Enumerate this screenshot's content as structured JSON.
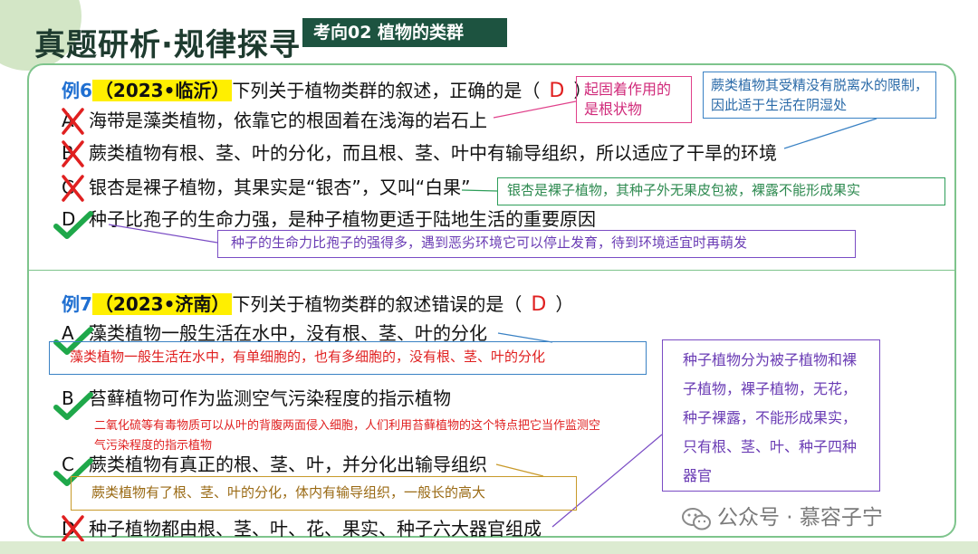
{
  "header": {
    "title": "真题研析·规律探寻",
    "topic": "考向02  植物的类群"
  },
  "q1": {
    "label": "例6",
    "source": "（2023•临沂）",
    "stem": "下列关于植物类群的叙述，正确的是（",
    "answer": "D",
    "close": "）",
    "options": [
      {
        "letter": "A",
        "text": "海带是藻类植物，依靠它的根固着在浅海的岩石上",
        "mark": "cross"
      },
      {
        "letter": "B",
        "text": "蕨类植物有根、茎、叶的分化，而且根、茎、叶中有输导组织，所以适应了干旱的环境",
        "mark": "cross"
      },
      {
        "letter": "C",
        "text": "银杏是裸子植物，其果实是“银杏”，又叫“白果”",
        "mark": "cross"
      },
      {
        "letter": "D",
        "text": "种子比孢子的生命力强，是种子植物更适于陆地生活的重要原因",
        "mark": "check"
      }
    ],
    "notes": {
      "a": "起固着作用的是根状物",
      "b": "蕨类植物其受精没有脱离水的限制，因此适于生活在阴湿处",
      "c": "银杏是裸子植物，其种子外无果皮包被，裸露不能形成果实",
      "d": "种子的生命力比孢子的强得多，遇到恶劣环境它可以停止发育，待到环境适宜时再萌发"
    }
  },
  "q2": {
    "label": "例7",
    "source": "（2023•济南）",
    "stem": "下列关于植物类群的叙述错误的是（",
    "answer": "D",
    "close": "）",
    "options": [
      {
        "letter": "A",
        "text": "藻类植物一般生活在水中，没有根、茎、叶的分化",
        "mark": "check"
      },
      {
        "letter": "B",
        "text": "苔藓植物可作为监测空气污染程度的指示植物",
        "mark": "check"
      },
      {
        "letter": "C",
        "text": "蕨类植物有真正的根、茎、叶，并分化出输导组织",
        "mark": "check"
      },
      {
        "letter": "D",
        "text": "种子植物都由根、茎、叶、花、果实、种子六大器官组成",
        "mark": "cross"
      }
    ],
    "notes": {
      "a": "藻类植物一般生活在水中，有单细胞的，也有多细胞的，没有根、茎、叶的分化",
      "b": "二氧化硫等有毒物质可以从叶的背腹两面侵入细胞，人们利用苔藓植物的这个特点把它当作监测空气污染程度的指示植物",
      "c": "蕨类植物有了根、茎、叶的分化，体内有输导组织，一般长的高大",
      "d": "种子植物分为被子植物和裸子植物，裸子植物，无花，种子裸露，不能形成果实，只有根、茎、叶、种子四种器官"
    }
  },
  "watermark": "公众号 · 慕容子宁",
  "colors": {
    "accent": "#1d5340",
    "border": "#7ec48c",
    "check": "#1fa84a",
    "cross": "#e02020",
    "label": "#1f6fd1",
    "highlight": "#ffef00"
  }
}
